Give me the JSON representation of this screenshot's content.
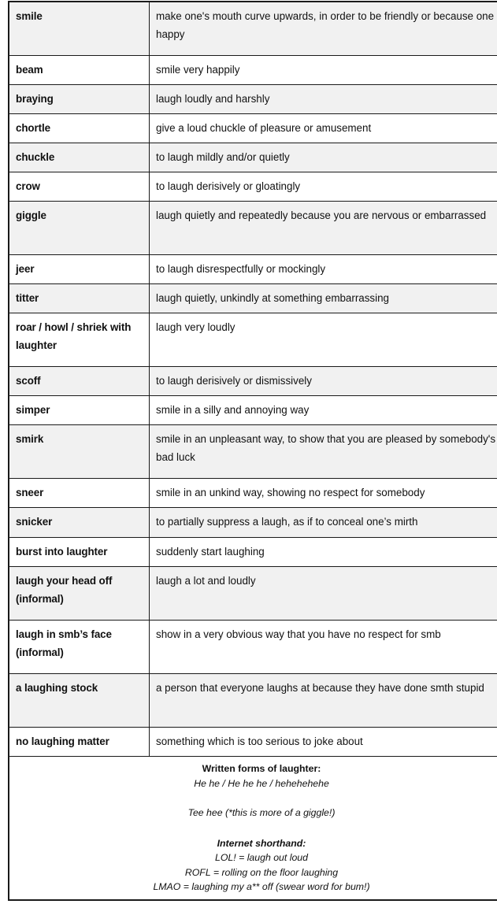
{
  "document": {
    "kind": "vocabulary-table",
    "title_visible": false,
    "colors": {
      "border": "#1a1a1a",
      "row_shade": "#f1f1f1",
      "row_plain": "#ffffff",
      "text": "#111111"
    }
  },
  "table": {
    "rows": [
      {
        "term": "smile",
        "definition": "make one's mouth curve upwards, in order to be friendly or because one is happy",
        "shaded": true,
        "tall": true
      },
      {
        "term": "beam",
        "definition": "smile very happily",
        "shaded": false,
        "tall": false
      },
      {
        "term": "braying",
        "definition": "laugh loudly and harshly",
        "shaded": true,
        "tall": false
      },
      {
        "term": "chortle",
        "definition": "give a loud chuckle of pleasure or amusement",
        "shaded": false,
        "tall": false
      },
      {
        "term": "chuckle",
        "definition": "to laugh mildly and/or quietly",
        "shaded": true,
        "tall": false
      },
      {
        "term": "crow",
        "definition": "to laugh derisively or gloatingly",
        "shaded": false,
        "tall": false
      },
      {
        "term": "giggle",
        "definition": "laugh quietly and repeatedly because you are nervous or embarrassed",
        "shaded": true,
        "tall": true
      },
      {
        "term": "jeer",
        "definition": "to laugh disrespectfully or mockingly",
        "shaded": false,
        "tall": false
      },
      {
        "term": "titter",
        "definition": "laugh quietly, unkindly at something embarrassing",
        "shaded": true,
        "tall": false
      },
      {
        "term": "roar / howl / shriek with laughter",
        "definition": "laugh very loudly",
        "shaded": false,
        "tall": true
      },
      {
        "term": "scoff",
        "definition": "to laugh derisively or dismissively",
        "shaded": true,
        "tall": false
      },
      {
        "term": "simper",
        "definition": "smile in a silly and annoying way",
        "shaded": false,
        "tall": false
      },
      {
        "term": "smirk",
        "definition": "smile in an unpleasant way, to show that you are pleased by somebody's bad luck",
        "shaded": true,
        "tall": true
      },
      {
        "term": "sneer",
        "definition": "smile in an unkind way, showing no respect for somebody",
        "shaded": false,
        "tall": false
      },
      {
        "term": "snicker",
        "definition": "to partially suppress a laugh, as if to conceal one’s mirth",
        "shaded": true,
        "tall": false
      },
      {
        "term": "burst into laughter",
        "definition": "suddenly start laughing",
        "shaded": false,
        "tall": false
      },
      {
        "term": "laugh your head off (informal)",
        "definition": "laugh a lot and loudly",
        "shaded": true,
        "tall": true
      },
      {
        "term": "laugh in smb’s face (informal)",
        "definition": "show in a very obvious way that you have no respect for smb",
        "shaded": false,
        "tall": true
      },
      {
        "term": "a laughing stock",
        "definition": "a person that everyone laughs at because they have done smth stupid",
        "shaded": true,
        "tall": true
      },
      {
        "term": "no laughing matter",
        "definition": "something which is too serious to joke about",
        "shaded": false,
        "tall": false
      }
    ]
  },
  "footer": {
    "written_forms_heading": "Written forms of laughter:",
    "written_forms_line1": "He he / He he he / hehehehehe",
    "written_forms_line2": "Tee hee (*this is more of a giggle!)",
    "internet_heading": "Internet shorthand:",
    "internet_line1": "LOL! = laugh out loud",
    "internet_line2": "ROFL = rolling on the floor laughing",
    "internet_line3": "LMAO = laughing my a** off (swear word for bum!)"
  }
}
